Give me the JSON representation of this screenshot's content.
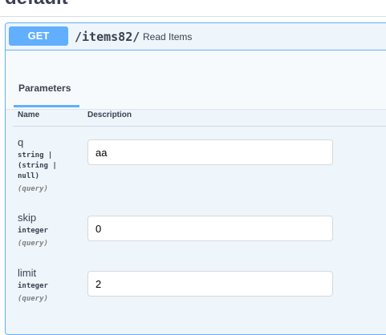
{
  "tag": {
    "title": "default"
  },
  "operation": {
    "method": "GET",
    "path": "/items82/",
    "summary": "Read Items"
  },
  "parameters": {
    "tab_label": "Parameters",
    "columns": {
      "name": "Name",
      "description": "Description"
    },
    "items": [
      {
        "name": "q",
        "type": "string |\n(string |\nnull)",
        "in": "(query)",
        "value": "aa"
      },
      {
        "name": "skip",
        "type": "integer",
        "in": "(query)",
        "value": "0"
      },
      {
        "name": "limit",
        "type": "integer",
        "in": "(query)",
        "value": "2"
      }
    ]
  },
  "colors": {
    "get_accent": "#61affe",
    "opblock_background": "#eef5fb"
  }
}
